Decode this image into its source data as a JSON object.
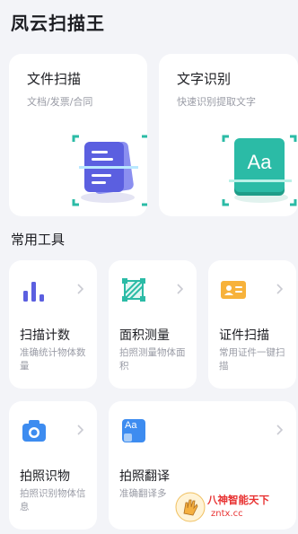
{
  "app": {
    "title": "凤云扫描王"
  },
  "feature_cards": [
    {
      "title": "文件扫描",
      "subtitle": "文档/发票/合同",
      "icon": "document-scan-icon"
    },
    {
      "title": "文字识别",
      "subtitle": "快速识别提取文字",
      "icon": "text-recognition-icon",
      "icon_text": "Aa"
    }
  ],
  "section": {
    "title": "常用工具"
  },
  "tools": [
    {
      "title": "扫描计数",
      "subtitle": "准确统计物体数量",
      "icon": "bar-chart-icon"
    },
    {
      "title": "面积测量",
      "subtitle": "拍照测量物体面积",
      "icon": "area-measure-icon"
    },
    {
      "title": "证件扫描",
      "subtitle": "常用证件一键扫描",
      "icon": "id-card-icon"
    },
    {
      "title": "拍照识物",
      "subtitle": "拍照识别物体信息",
      "icon": "camera-icon"
    },
    {
      "title": "拍照翻译",
      "subtitle": "准确翻译多",
      "icon": "translate-icon",
      "icon_text": "Aa"
    }
  ],
  "watermark": {
    "line1": "八神智能天下",
    "line2": "zntx.cc"
  },
  "colors": {
    "background": "#f3f4f8",
    "card": "#ffffff",
    "accent_purple": "#5b5fe0",
    "accent_teal": "#2bbba6",
    "accent_orange": "#f7b23b",
    "accent_blue": "#3d8cf0",
    "watermark_red": "#e83232"
  }
}
